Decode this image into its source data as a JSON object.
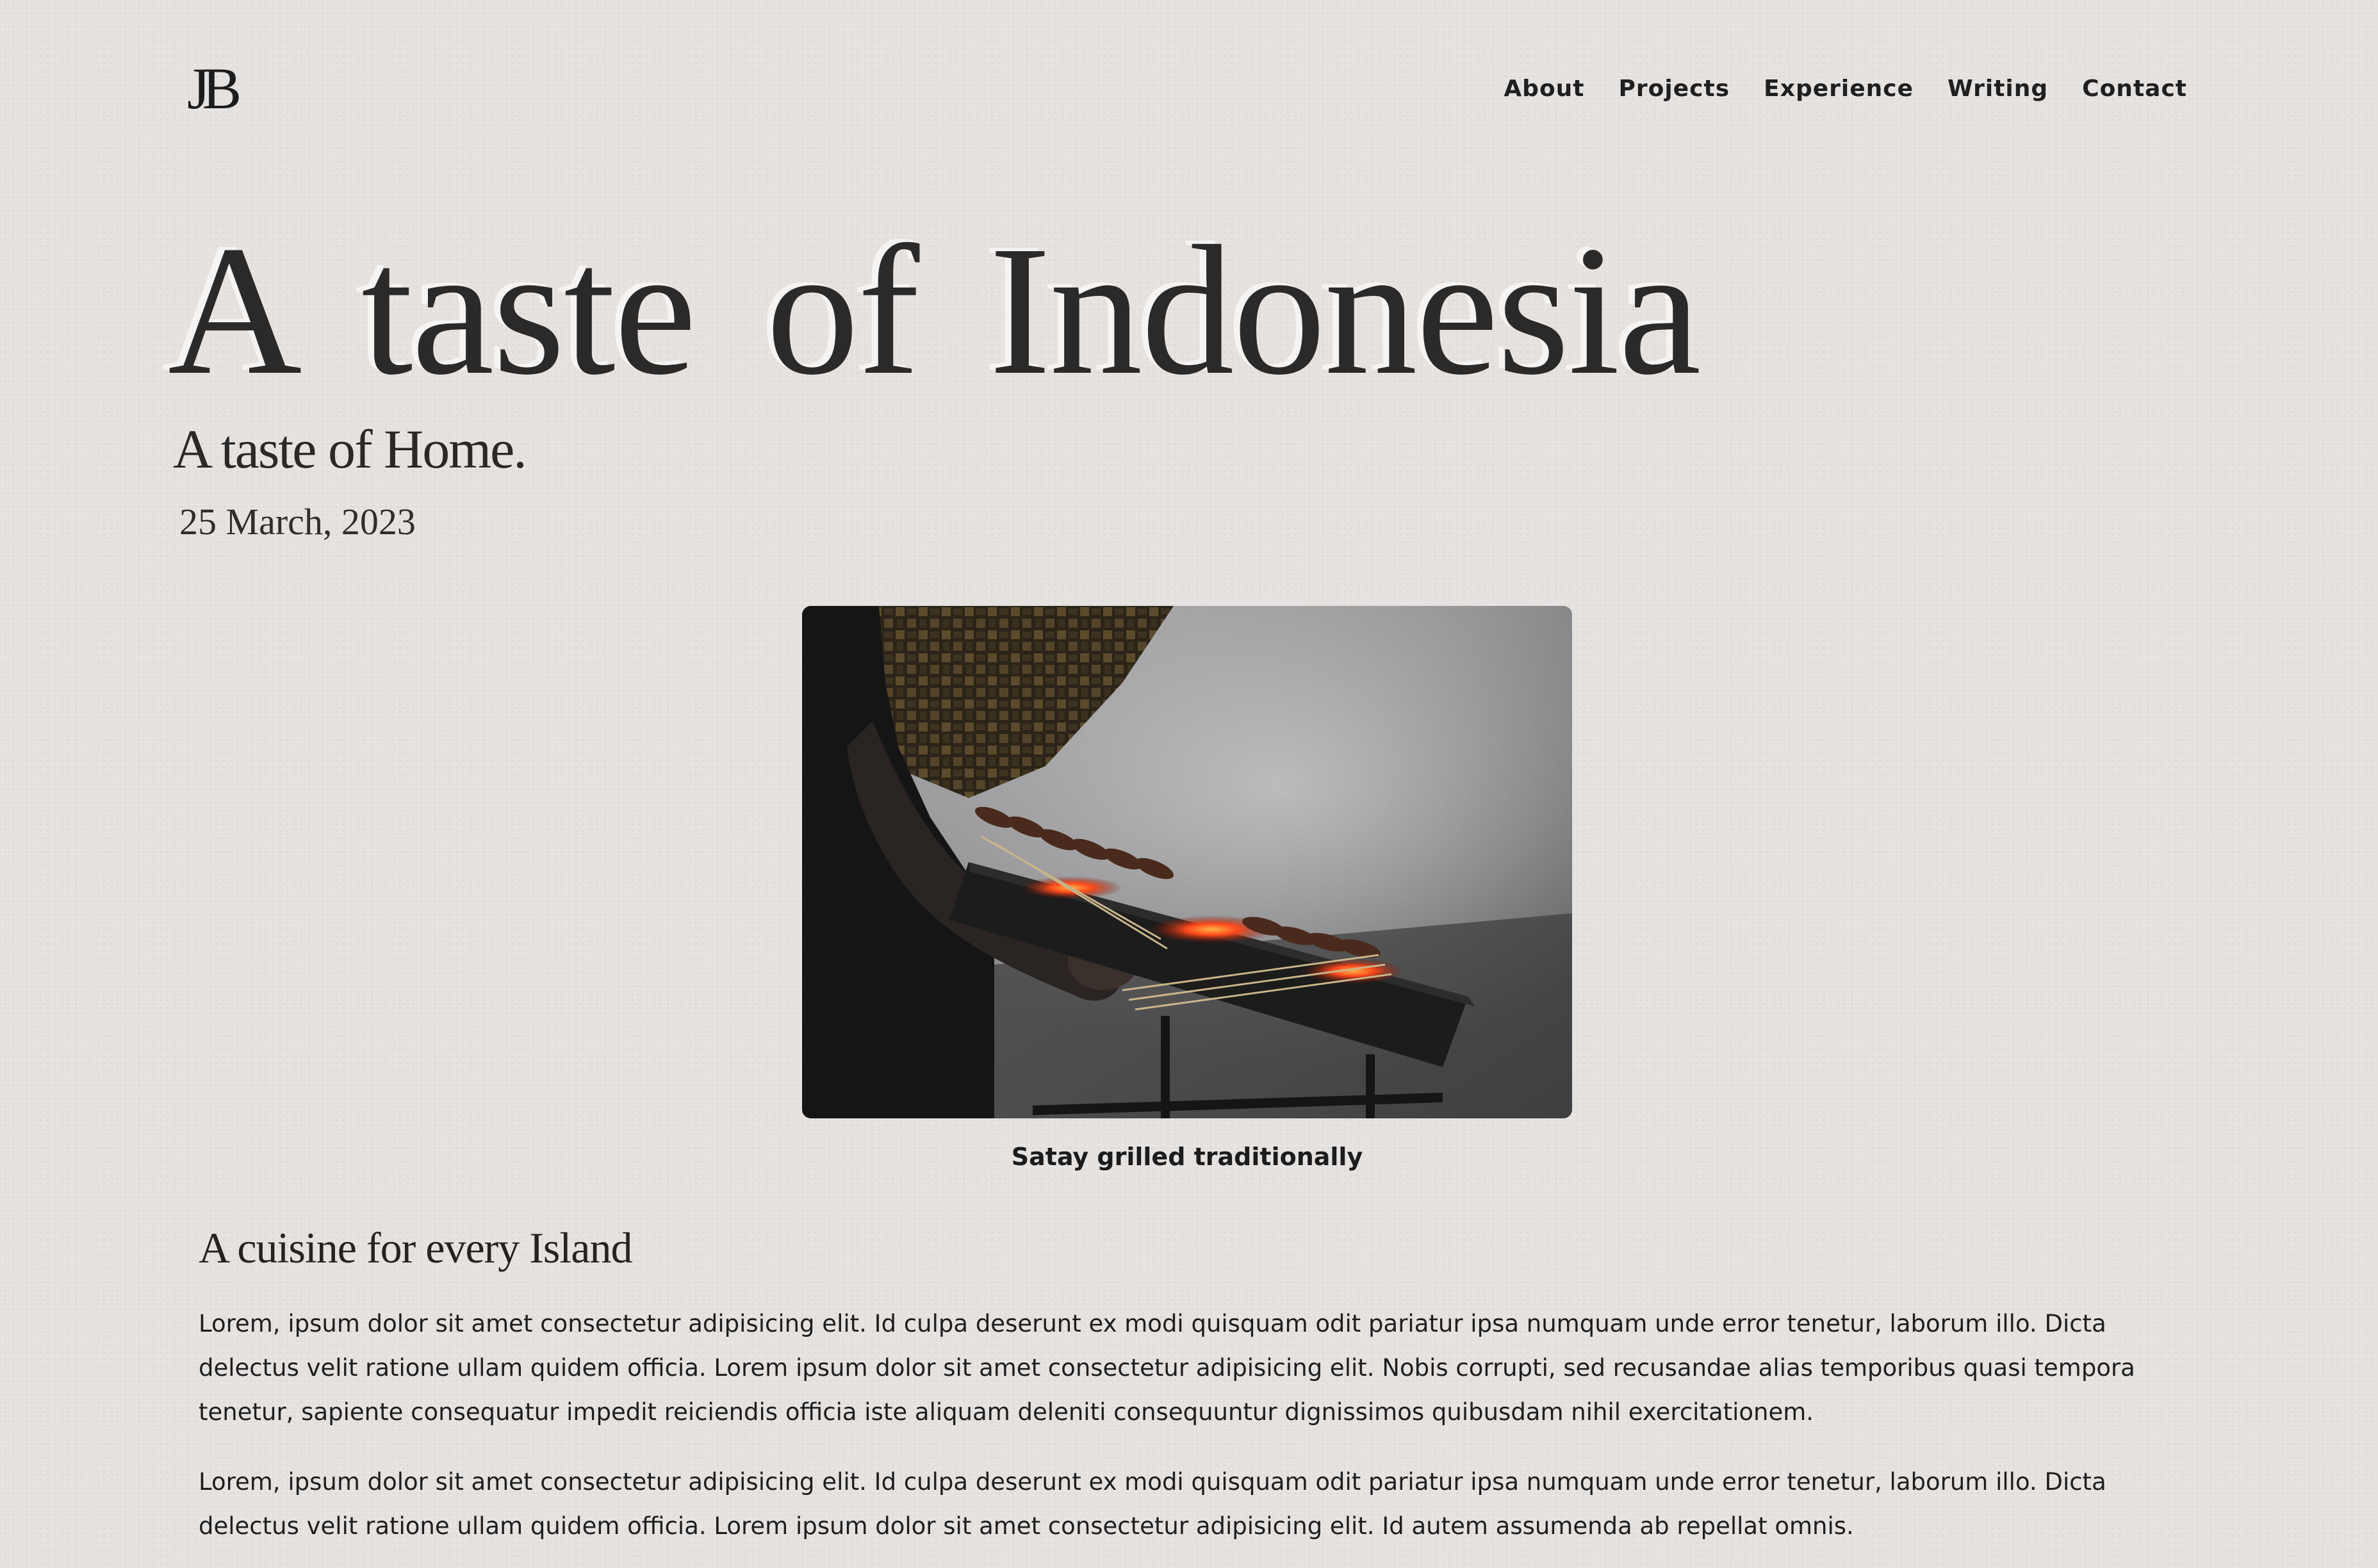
{
  "header": {
    "logo": "JB",
    "nav": [
      "About",
      "Projects",
      "Experience",
      "Writing",
      "Contact"
    ]
  },
  "hero": {
    "title": "A taste of Indonesia",
    "subtitle": "A taste of Home.",
    "date": "25 March, 2023"
  },
  "figure": {
    "image_description_icon": "satay-grill-photo",
    "caption": "Satay grilled traditionally"
  },
  "article": {
    "heading": "A cuisine for every Island",
    "paragraphs": [
      "Lorem, ipsum dolor sit amet consectetur adipisicing elit. Id culpa deserunt ex modi quisquam odit pariatur ipsa numquam unde error tenetur, laborum illo. Dicta delectus velit ratione ullam quidem officia. Lorem ipsum dolor sit amet consectetur adipisicing elit. Nobis corrupti, sed recusandae alias temporibus quasi tempora tenetur, sapiente consequatur impedit reiciendis officia iste aliquam deleniti consequuntur dignissimos quibusdam nihil exercitationem.",
      "Lorem, ipsum dolor sit amet consectetur adipisicing elit. Id culpa deserunt ex modi quisquam odit pariatur ipsa numquam unde error tenetur, laborum illo. Dicta delectus velit ratione ullam quidem officia. Lorem ipsum dolor sit amet consectetur adipisicing elit. Id autem assumenda ab repellat omnis."
    ]
  },
  "colors": {
    "background": "#e4e1df",
    "text": "#222222",
    "ember": "#ff4a1c"
  }
}
